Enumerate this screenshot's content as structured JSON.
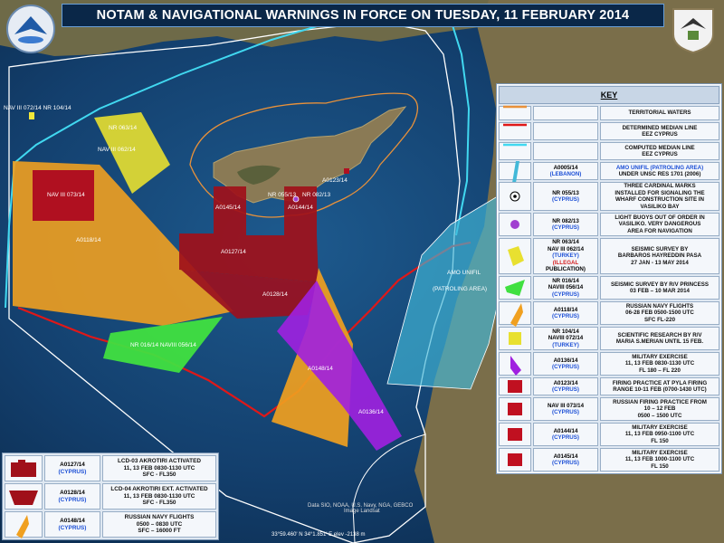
{
  "title": "NOTAM & NAVIGATIONAL WARNINGS IN FORCE ON TUESDAY, 11 FEBRUARY 2014",
  "map_labels": {
    "navtex_072_104": "NAV III 072/14  NR 104/14",
    "nr_063": "NR 063/14",
    "nr_062": "NAV III 062/14",
    "nav_073": "NAV III 073/14",
    "a0118": "A0118/14",
    "a0123": "A0123/14",
    "nr055": "NR 055/13",
    "nr082": "NR 082/13",
    "a0145": "A0145/14",
    "a0144": "A0144/14",
    "a0127": "A0127/14",
    "a0128": "A0128/14",
    "a0148": "A0148/14",
    "a0136": "A0136/14",
    "nr016": "NR 016/14  NAVIII 056/14",
    "amo_unifil": "AMO UNIFIL",
    "patroling": "(PATROLING AREA)"
  },
  "credits": "Data SIO, NOAA, U.S. Navy, NGA, GEBCO",
  "credits2": "Image Landsat",
  "status_bar": "33°59.460' N   34°1.851' E   elev -2138 m",
  "key": {
    "title": "KEY",
    "rows": [
      {
        "ref": [],
        "desc": [
          "TERRITORIAL WATERS"
        ],
        "symbol": "orange-line-icon"
      },
      {
        "ref": [],
        "desc": [
          "DETERMINED MEDIAN LINE",
          "EEZ CYPRUS"
        ],
        "symbol": "red-line-icon"
      },
      {
        "ref": [],
        "desc": [
          "COMPUTED MEDIAN LINE",
          "EEZ CYPRUS"
        ],
        "symbol": "cyan-line-icon"
      },
      {
        "ref": [
          "A0005/14",
          "(LEBANON)"
        ],
        "desc": [
          "AMO UNIFIL (PATROLING AREA)",
          "UNDER UNSC RES 1701 (2006)"
        ],
        "symbol": "cyan-area-icon"
      },
      {
        "ref": [
          "NR 055/13",
          "(CYPRUS)"
        ],
        "desc": [
          "THREE CARDINAL MARKS",
          "INSTALLED FOR SIGNALING THE",
          "WHARF CONSTRUCTION SITE IN",
          "VASILIKO BAY"
        ],
        "symbol": "target-dot-icon"
      },
      {
        "ref": [
          "NR 082/13",
          "(CYPRUS)"
        ],
        "desc": [
          "LIGHT BUOYS OUT OF ORDER IN",
          "VASILIKO. VERY DANGEROUS",
          "AREA FOR NAVIGATION"
        ],
        "symbol": "purple-dot-icon"
      },
      {
        "ref": [
          "NR 063/14",
          "NAV III 062/14",
          "(TURKEY)",
          "(ILLEGAL",
          "PUBLICATION)"
        ],
        "desc": [
          "SEISMIC SURVEY BY",
          "BARBAROS HAYREDDIN PASA",
          "27 JAN - 13 MAY 2014"
        ],
        "symbol": "yellow-area-icon"
      },
      {
        "ref": [
          "NR 016/14",
          "NAVIII 056/14",
          "(CYPRUS)"
        ],
        "desc": [
          "SEISMIC SURVEY BY R/V PRINCESS",
          "03 FEB – 10 MAR 2014"
        ],
        "symbol": "green-area-icon"
      },
      {
        "ref": [
          "A0118/14",
          "(CYPRUS)"
        ],
        "desc": [
          "RUSSIAN NAVY FLIGHTS",
          "06-28 FEB 0500-1500  UTC",
          "SFC FL-220"
        ],
        "symbol": "orange-area-icon"
      },
      {
        "ref": [
          "NR 104/14",
          "NAVIII 072/14",
          "(TURKEY)"
        ],
        "desc": [
          "SCIENTIFIC RESEARCH BY R/V",
          "MARIA S.MERIAN UNTIL 15 FEB."
        ],
        "symbol": "yellow-square-icon"
      },
      {
        "ref": [
          "A0136/14",
          "(CYPRUS)"
        ],
        "desc": [
          "MILITARY EXERCISE",
          "11, 13 FEB 0830-1130  UTC",
          "FL 180 – FL 220"
        ],
        "symbol": "purple-area-icon"
      },
      {
        "ref": [
          "A0123/14",
          "(CYPRUS)"
        ],
        "desc": [
          "FIRING PRACTICE AT PYLA FIRING",
          "RANGE 10-11 FEB (0700-1430 UTC)"
        ],
        "symbol": "red-square-icon"
      },
      {
        "ref": [
          "NAV III 073/14",
          "(CYPRUS)"
        ],
        "desc": [
          "RUSSIAN FIRING PRACTICE  FROM",
          "10 – 12 FEB",
          "0500 – 1500 UTC"
        ],
        "symbol": "red-square-icon"
      },
      {
        "ref": [
          "A0144/14",
          "(CYPRUS)"
        ],
        "desc": [
          "MILITARY EXERCISE",
          "11, 13 FEB 0950-1100  UTC",
          "FL 150"
        ],
        "symbol": "red-square-icon"
      },
      {
        "ref": [
          "A0145/14",
          "(CYPRUS)"
        ],
        "desc": [
          "MILITARY EXERCISE",
          "11, 13 FEB 1000-1100  UTC",
          "FL 150"
        ],
        "symbol": "red-square-icon"
      }
    ]
  },
  "bottom_key": {
    "rows": [
      {
        "ref": [
          "A0127/14",
          "(CYPRUS)"
        ],
        "desc": [
          "LCD-03 AKROTIRI ACTIVATED",
          "11, 13 FEB 0830-1130  UTC",
          "SFC - FL350"
        ],
        "symbol": "darkred-shape-icon"
      },
      {
        "ref": [
          "A0128/14",
          "(CYPRUS)"
        ],
        "desc": [
          "LCD-04 AKROTIRI EXT. ACTIVATED",
          "11, 13 FEB 0830-1130  UTC",
          "SFC - FL350"
        ],
        "symbol": "darkred-trapezoid-icon"
      },
      {
        "ref": [
          "A0148/14",
          "(CYPRUS)"
        ],
        "desc": [
          "RUSSIAN NAVY FLIGHTS",
          "0500 – 0830  UTC",
          "SFC – 16000  FT"
        ],
        "symbol": "orange-area-icon"
      }
    ]
  },
  "colors": {
    "sea": "#123e6b",
    "land": "#8a7a55",
    "territorial": "#e8913a",
    "median_red": "#e01818",
    "median_cyan": "#41d8f0",
    "orange_area": "#f0a020",
    "darkred": "#a0101a",
    "purple": "#a020e0",
    "yellow": "#e8e030",
    "green": "#40e040",
    "unifil": "#42b8d8"
  }
}
